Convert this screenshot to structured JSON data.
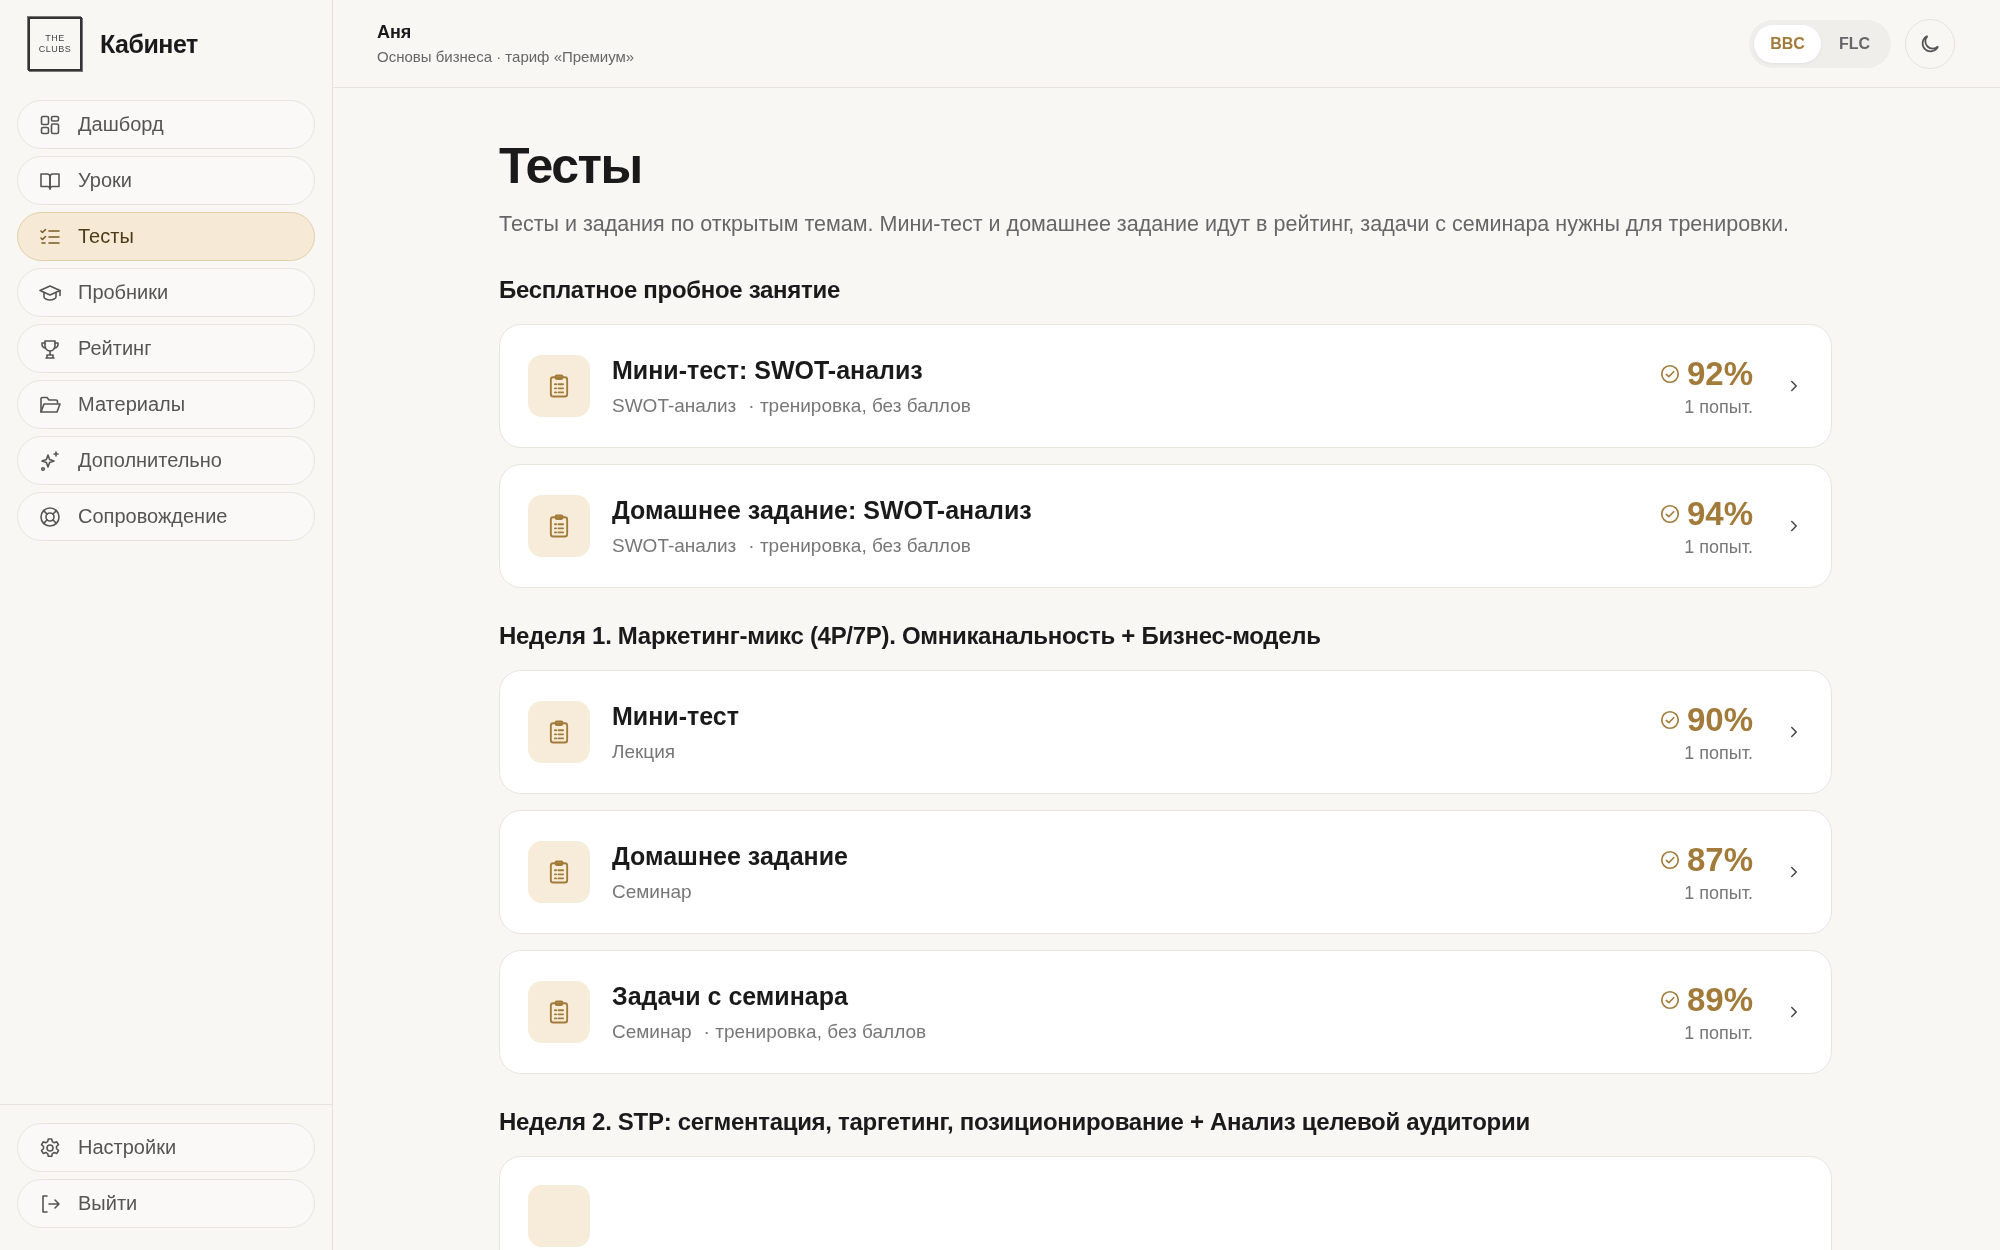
{
  "brand": {
    "logo_lines": [
      "THE",
      "CLUBS"
    ],
    "title": "Кабинет"
  },
  "nav": [
    {
      "label": "Дашборд",
      "selected": false
    },
    {
      "label": "Уроки",
      "selected": false
    },
    {
      "label": "Тесты",
      "selected": true
    },
    {
      "label": "Пробники",
      "selected": false
    },
    {
      "label": "Рейтинг",
      "selected": false
    },
    {
      "label": "Материалы",
      "selected": false
    },
    {
      "label": "Дополнительно",
      "selected": false
    },
    {
      "label": "Сопровождение",
      "selected": false
    }
  ],
  "nav_bottom": [
    {
      "label": "Настройки"
    },
    {
      "label": "Выйти"
    }
  ],
  "header": {
    "user": "Аня",
    "subtitle": "Основы бизнеса · тариф «Премиум»",
    "languages": [
      {
        "label": "BBC",
        "selected": true
      },
      {
        "label": "FLC",
        "selected": false
      }
    ]
  },
  "page": {
    "title": "Тесты",
    "description": "Тесты и задания по открытым темам. Мини-тест и домашнее задание идут в рейтинг, задачи с семинара нужны для тренировки."
  },
  "sections": [
    {
      "title": "Бесплатное пробное занятие",
      "items": [
        {
          "kind": "test",
          "title": "Мини-тест: SWOT-анализ",
          "topic": "SWOT-анализ",
          "note": "· тренировка, без баллов",
          "score": "92%",
          "attempts": "1 попыт."
        },
        {
          "kind": "test",
          "title": "Домашнее задание: SWOT-анализ",
          "topic": "SWOT-анализ",
          "note": "· тренировка, без баллов",
          "score": "94%",
          "attempts": "1 попыт."
        }
      ]
    },
    {
      "title": "Неделя 1. Маркетинг-микс (4P/7P). Омниканальность + Бизнес-модель",
      "items": [
        {
          "kind": "test",
          "title": "Мини-тест",
          "topic": "Лекция",
          "score": "90%",
          "attempts": "1 попыт."
        },
        {
          "kind": "test",
          "title": "Домашнее задание",
          "topic": "Семинар",
          "score": "87%",
          "attempts": "1 попыт."
        },
        {
          "kind": "test",
          "title": "Задачи с семинара",
          "topic": "Семинар",
          "note": "· тренировка, без баллов",
          "score": "89%",
          "attempts": "1 попыт."
        }
      ]
    },
    {
      "title": "Неделя 2. STP: сегментация, таргетинг, позиционирование + Анализ целевой аудитории",
      "items": [
        {
          "kind": "partial"
        }
      ]
    }
  ]
}
